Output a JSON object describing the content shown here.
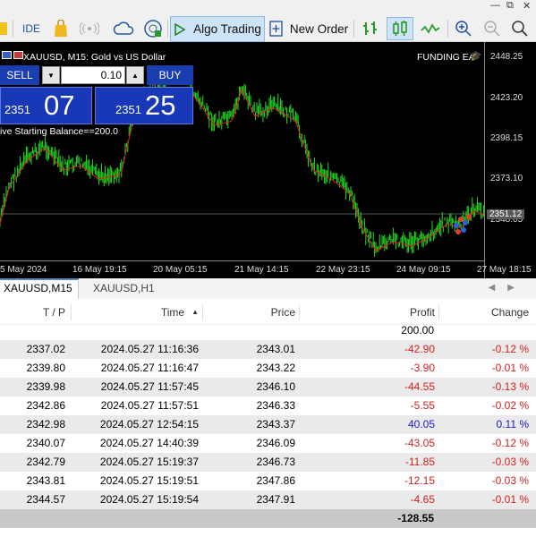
{
  "toolbar": {
    "ide_label": "IDE",
    "algo_label": "Algo Trading",
    "new_order_label": "New Order"
  },
  "chart": {
    "title": "XAUUSD, M15:  Gold vs US Dollar",
    "ea_label": "FUNDING EA",
    "status_line": "ive Starting Balance==200.0",
    "price_labels": [
      "2448.25",
      "2423.20",
      "2398.15",
      "2373.10",
      "2348.05"
    ],
    "current_price": "2351.12",
    "time_labels": [
      "5 May 2024",
      "16 May 19:15",
      "20 May 05:15",
      "21 May 14:15",
      "22 May 23:15",
      "24 May 09:15",
      "27 May 18:15"
    ]
  },
  "trade_panel": {
    "sell_label": "SELL",
    "buy_label": "BUY",
    "volume": "0.10",
    "sell_small": "2351",
    "sell_big": "07",
    "buy_small": "2351",
    "buy_big": "25"
  },
  "tabs": [
    "XAUUSD,M15",
    "XAUUSD,H1"
  ],
  "table": {
    "headers": {
      "tp": "T / P",
      "time": "Time",
      "price": "Price",
      "profit": "Profit",
      "change": "Change"
    },
    "balance_profit": "200.00",
    "rows": [
      {
        "tp": "2337.02",
        "time": "2024.05.27 11:16:36",
        "price": "2343.01",
        "profit": "-42.90",
        "change": "-0.12 %"
      },
      {
        "tp": "2339.80",
        "time": "2024.05.27 11:16:47",
        "price": "2343.22",
        "profit": "-3.90",
        "change": "-0.01 %"
      },
      {
        "tp": "2339.98",
        "time": "2024.05.27 11:57:45",
        "price": "2346.10",
        "profit": "-44.55",
        "change": "-0.13 %"
      },
      {
        "tp": "2342.86",
        "time": "2024.05.27 11:57:51",
        "price": "2346.33",
        "profit": "-5.55",
        "change": "-0.02 %"
      },
      {
        "tp": "2342.98",
        "time": "2024.05.27 12:54:15",
        "price": "2343.37",
        "profit": "40.05",
        "change": "0.11 %"
      },
      {
        "tp": "2340.07",
        "time": "2024.05.27 14:40:39",
        "price": "2346.09",
        "profit": "-43.05",
        "change": "-0.12 %"
      },
      {
        "tp": "2342.79",
        "time": "2024.05.27 15:19:37",
        "price": "2346.73",
        "profit": "-11.85",
        "change": "-0.03 %"
      },
      {
        "tp": "2343.81",
        "time": "2024.05.27 15:19:51",
        "price": "2347.86",
        "profit": "-12.15",
        "change": "-0.03 %"
      },
      {
        "tp": "2344.57",
        "time": "2024.05.27 15:19:54",
        "price": "2347.91",
        "profit": "-4.65",
        "change": "-0.01 %"
      }
    ],
    "total_profit": "-128.55"
  },
  "colors": {
    "candle_up": "#22e022",
    "ma_line": "#e02020",
    "panel_blue": "#1938b8",
    "loss": "#d42020",
    "gain": "#1a1ad0"
  }
}
